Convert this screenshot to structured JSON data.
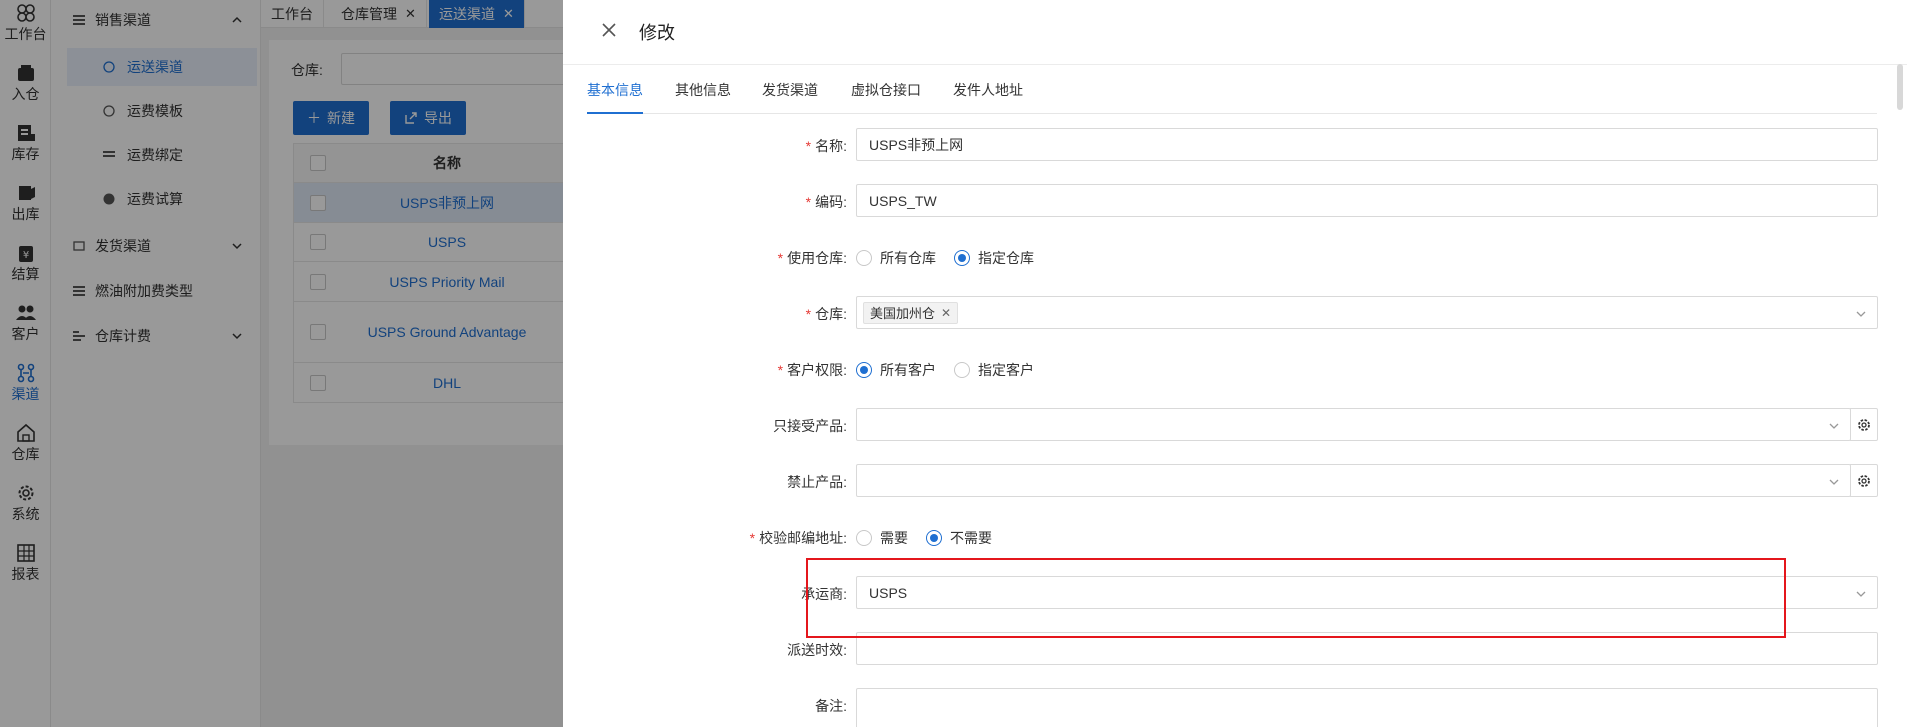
{
  "rail": [
    {
      "icon": "grid-icon",
      "label": "工作台"
    },
    {
      "icon": "inbound-icon",
      "label": "入仓"
    },
    {
      "icon": "inventory-icon",
      "label": "库存"
    },
    {
      "icon": "outbound-icon",
      "label": "出库"
    },
    {
      "icon": "settlement-icon",
      "label": "结算"
    },
    {
      "icon": "customers-icon",
      "label": "客户"
    },
    {
      "icon": "channel-icon",
      "label": "渠道"
    },
    {
      "icon": "warehouse-icon",
      "label": "仓库"
    },
    {
      "icon": "gear-icon",
      "label": "系统"
    },
    {
      "icon": "report-icon",
      "label": "报表"
    }
  ],
  "submenu": {
    "group1": "销售渠道",
    "items": [
      "运送渠道",
      "运费模板",
      "运费绑定",
      "运费试算"
    ],
    "group2": "发货渠道",
    "group3": "燃油附加费类型",
    "group4": "仓库计费"
  },
  "tabs": [
    {
      "label": "工作台",
      "closable": false
    },
    {
      "label": "仓库管理",
      "closable": true
    },
    {
      "label": "运送渠道",
      "closable": true
    }
  ],
  "page": {
    "warehouse_label": "仓库:",
    "new_button": "新建",
    "export_button": "导出",
    "table_name_header": "名称",
    "rows": [
      "USPS非预上网",
      "USPS",
      "USPS Priority Mail",
      "USPS Ground Advantage",
      "DHL"
    ]
  },
  "drawer": {
    "title": "修改",
    "tabs": [
      "基本信息",
      "其他信息",
      "发货渠道",
      "虚拟仓接口",
      "发件人地址"
    ],
    "fields": {
      "name_label": "名称:",
      "name_value": "USPS非预上网",
      "code_label": "编码:",
      "code_value": "USPS_TW",
      "use_wh_label": "使用仓库:",
      "use_wh_opt1": "所有仓库",
      "use_wh_opt2": "指定仓库",
      "wh_label": "仓库:",
      "wh_tag": "美国加州仓",
      "cust_label": "客户权限:",
      "cust_opt1": "所有客户",
      "cust_opt2": "指定客户",
      "accept_label": "只接受产品:",
      "forbid_label": "禁止产品:",
      "zip_label": "校验邮编地址:",
      "zip_opt1": "需要",
      "zip_opt2": "不需要",
      "carrier_label": "承运商:",
      "carrier_value": "USPS",
      "delivery_label": "派送时效:",
      "remark_label": "备注:"
    }
  },
  "colors": {
    "accent": "#1f6fd1",
    "required": "#e53935",
    "highlight_box": "#e4161c"
  }
}
